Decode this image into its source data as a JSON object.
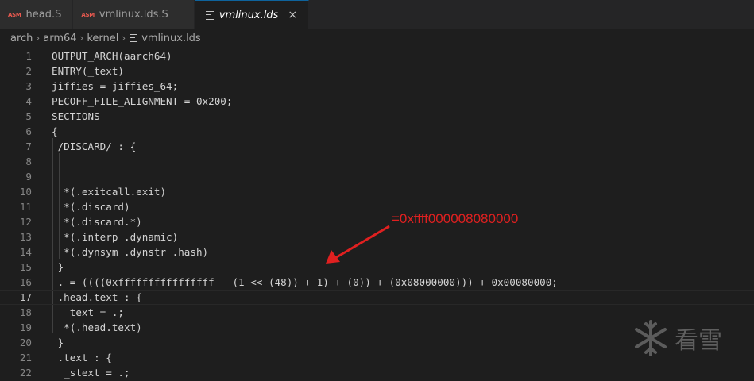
{
  "tabs": [
    {
      "badge": "ASM",
      "label": "head.S",
      "active": false
    },
    {
      "badge": "ASM",
      "label": "vmlinux.lds.S",
      "active": false
    },
    {
      "label": "vmlinux.lds",
      "active": true,
      "close": "×"
    }
  ],
  "breadcrumb": [
    "arch",
    "arm64",
    "kernel",
    "vmlinux.lds"
  ],
  "editor": {
    "lines": [
      {
        "n": "1",
        "text": "OUTPUT_ARCH(aarch64)"
      },
      {
        "n": "2",
        "text": "ENTRY(_text)"
      },
      {
        "n": "3",
        "text": "jiffies = jiffies_64;"
      },
      {
        "n": "4",
        "text": "PECOFF_FILE_ALIGNMENT = 0x200;"
      },
      {
        "n": "5",
        "text": "SECTIONS"
      },
      {
        "n": "6",
        "text": "{"
      },
      {
        "n": "7",
        "text": " /DISCARD/ : {"
      },
      {
        "n": "8",
        "text": ""
      },
      {
        "n": "9",
        "text": ""
      },
      {
        "n": "10",
        "text": "  *(.exitcall.exit)"
      },
      {
        "n": "11",
        "text": "  *(.discard)"
      },
      {
        "n": "12",
        "text": "  *(.discard.*)"
      },
      {
        "n": "13",
        "text": "  *(.interp .dynamic)"
      },
      {
        "n": "14",
        "text": "  *(.dynsym .dynstr .hash)"
      },
      {
        "n": "15",
        "text": " }"
      },
      {
        "n": "16",
        "text": " . = ((((0xffffffffffffffff - (1 << (48)) + 1) + (0)) + (0x08000000))) + 0x00080000;"
      },
      {
        "n": "17",
        "text": " .head.text : {",
        "current": true
      },
      {
        "n": "18",
        "text": "  _text = .;"
      },
      {
        "n": "19",
        "text": "  *(.head.text)"
      },
      {
        "n": "20",
        "text": " }"
      },
      {
        "n": "21",
        "text": " .text : {"
      },
      {
        "n": "22",
        "text": "  _stext = .;"
      }
    ]
  },
  "annotation": {
    "text": "=0xffff000008080000",
    "color": "#e02020"
  },
  "watermark": {
    "text": "看雪"
  },
  "colors": {
    "background": "#1e1e1e",
    "tabbar": "#252526",
    "asm_badge": "#e8594f"
  }
}
